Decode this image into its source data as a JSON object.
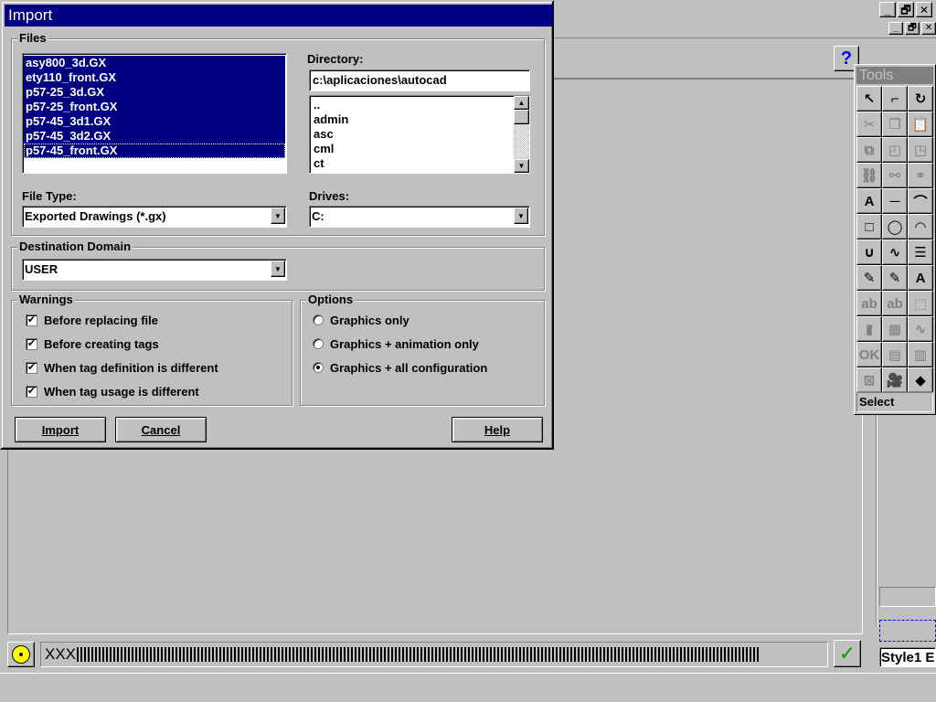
{
  "dialog": {
    "title": "Import",
    "files_group": "Files",
    "files": [
      "asy800_3d.GX",
      "ety110_front.GX",
      "p57-25_3d.GX",
      "p57-25_front.GX",
      "p57-45_3d1.GX",
      "p57-45_3d2.GX",
      "p57-45_front.GX"
    ],
    "directory_label": "Directory:",
    "directory_value": "c:\\aplicaciones\\autocad",
    "directories": [
      "..",
      "admin",
      "asc",
      "cml",
      "ct"
    ],
    "file_type_label": "File Type:",
    "file_type_value": "Exported Drawings (*.gx)",
    "drives_label": "Drives:",
    "drives_value": "C:",
    "destination_label": "Destination Domain",
    "destination_value": "USER",
    "warnings_label": "Warnings",
    "warnings": [
      {
        "label": "Before replacing file",
        "checked": true
      },
      {
        "label": "Before creating tags",
        "checked": true
      },
      {
        "label": "When tag definition is different",
        "checked": true
      },
      {
        "label": "When tag usage is different",
        "checked": true
      }
    ],
    "options_label": "Options",
    "options": [
      {
        "label": "Graphics only",
        "selected": false
      },
      {
        "label": "Graphics + animation only",
        "selected": false
      },
      {
        "label": "Graphics + all configuration",
        "selected": true
      }
    ],
    "import_button": "Import",
    "cancel_button": "Cancel",
    "help_button": "Help"
  },
  "app": {
    "help_glyph": "?",
    "status_text": "XXX",
    "style_text": "Style1 E",
    "minimize_glyph": "_",
    "restore_glyph": "🗗",
    "close_glyph": "✕"
  },
  "tools": {
    "title": "Tools",
    "status": "Select",
    "icons": [
      "pointer-icon",
      "polyline-icon",
      "rotate-icon",
      "cut-icon",
      "copy-icon",
      "paste-icon",
      "group-icon",
      "bring-front-icon",
      "send-back-icon",
      "link-icon",
      "link-break-icon",
      "link-edit-icon",
      "text-icon",
      "line-icon",
      "polygon-icon",
      "rectangle-icon",
      "ellipse-icon",
      "arc-icon",
      "curve-icon",
      "wave-icon",
      "align-icon",
      "pen-color-icon",
      "fill-color-icon",
      "font-color-icon",
      "text-field-icon",
      "input-field-icon",
      "symbol-icon",
      "bar-chart-icon",
      "numeric-icon",
      "trend-icon",
      "alarm-icon",
      "list-icon",
      "grid-icon",
      "x-icon",
      "camera-icon",
      "eraser-icon"
    ],
    "glyphs": [
      "↖",
      "⌐",
      "↻",
      "✂",
      "❐",
      "📋",
      "⧉",
      "◰",
      "◳",
      "⛓",
      "⚯",
      "⚭",
      "A",
      "─",
      "⌒",
      "□",
      "◯",
      "◠",
      "∪",
      "∿",
      "☰",
      "✎",
      "✎",
      "A",
      "ab",
      "ab",
      "⬚",
      "▮",
      "▦",
      "∿",
      "OK",
      "▤",
      "▥",
      "⊠",
      "🎥",
      "◆"
    ]
  }
}
